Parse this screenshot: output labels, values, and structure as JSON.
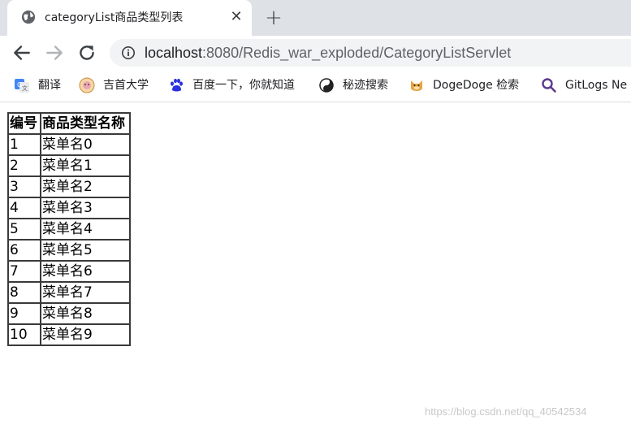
{
  "tab": {
    "title": "categoryList商品类型列表",
    "close_label": "✕",
    "new_tab_label": "+"
  },
  "address": {
    "host": "localhost",
    "rest": ":8080/Redis_war_exploded/CategoryListServlet"
  },
  "bookmarks": [
    {
      "label": "翻译",
      "icon": "google-translate-icon"
    },
    {
      "label": "吉首大学",
      "icon": "university-icon"
    },
    {
      "label": "百度一下，你就知道",
      "icon": "baidu-paw-icon"
    },
    {
      "label": "秘迹搜索",
      "icon": "mijisou-icon"
    },
    {
      "label": "DogeDoge 检索",
      "icon": "dogedoge-icon"
    },
    {
      "label": "GitLogs Ne",
      "icon": "magnifier-icon"
    }
  ],
  "table": {
    "headers": [
      "编号",
      "商品类型名称"
    ],
    "rows": [
      [
        "1",
        "菜单名0"
      ],
      [
        "2",
        "菜单名1"
      ],
      [
        "3",
        "菜单名2"
      ],
      [
        "4",
        "菜单名3"
      ],
      [
        "5",
        "菜单名4"
      ],
      [
        "6",
        "菜单名5"
      ],
      [
        "7",
        "菜单名6"
      ],
      [
        "8",
        "菜单名7"
      ],
      [
        "9",
        "菜单名8"
      ],
      [
        "10",
        "菜单名9"
      ]
    ]
  },
  "watermark": "https://blog.csdn.net/qq_40542534",
  "colors": {
    "tabstrip": "#dee1e6",
    "omnibox": "#f1f3f4",
    "table_border": "#3a3a3a"
  }
}
